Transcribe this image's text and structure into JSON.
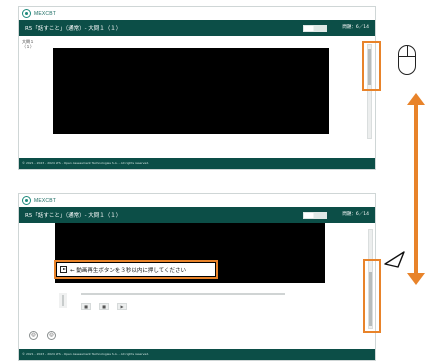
{
  "app": {
    "logo_text": "MEXCBT"
  },
  "test": {
    "title": "R5「話すこと」（通常）- 大問１（１）",
    "question_counter": "問題：6／14",
    "progress": 0.43
  },
  "sidebar": {
    "question_label": "大問１\n（１）"
  },
  "player": {
    "play_instruction": "←  動画再生ボタンを３秒以内に押してください",
    "stop_label": "■",
    "pause_label": "■",
    "play_label": "▶"
  },
  "nav": {
    "prev_label": "◎",
    "next_label": "◎"
  },
  "footer": {
    "copyright": "© 2021 - 2023 - 2024 LTS - Open Assessment Technologies S.A. - All rights reserved."
  },
  "annotation": {
    "highlight_color": "#e8832a",
    "arrow_color": "#e8832a"
  }
}
